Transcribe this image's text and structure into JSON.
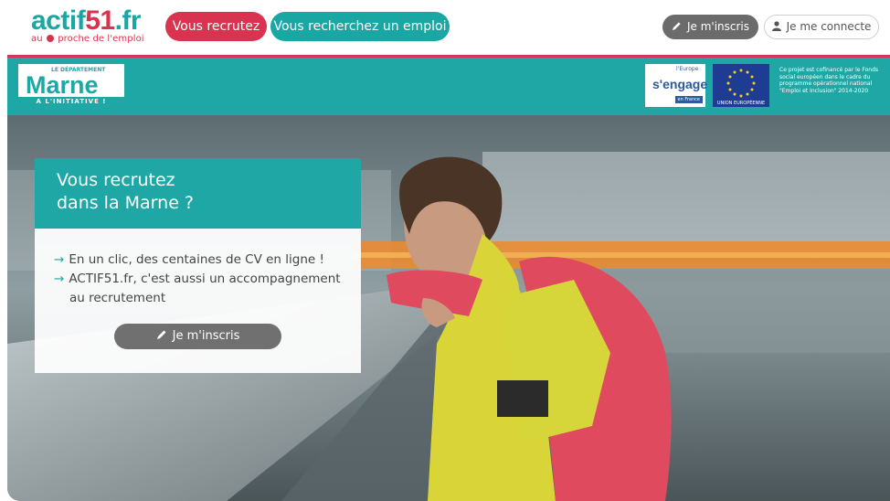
{
  "header": {
    "logo_main_a": "actif",
    "logo_main_b": "51",
    "logo_main_c": ".fr",
    "logo_sub_a": "au",
    "logo_sub_b": "proche de l'emploi",
    "nav": {
      "recruit_label": "Vous recrutez",
      "search_label": "Vous recherchez un emploi"
    },
    "signup_label": "Je m'inscris",
    "login_label": "Je me connecte"
  },
  "partner_band": {
    "marne_dept": "LE DÉPARTEMENT",
    "marne_name": "Marne",
    "marne_tagline": "A L'INITIATIVE !",
    "europe_small": "l'Europe",
    "europe_big": "s'engage",
    "europe_country": "en France",
    "eu_label": "UNION EUROPÉENNE",
    "eu_text": "Ce projet est cofinancé par le Fonds social européen dans le cadre du programme opérationnel national \"Emploi et Inclusion\" 2014-2020"
  },
  "hero": {
    "title_line1": "Vous recrutez",
    "title_line2": "dans la Marne ?",
    "bullet1": "En un clic, des centaines de CV en ligne !",
    "bullet2": "ACTIF51.fr, c'est aussi un accompagnement",
    "bullet2_cont": "au recrutement",
    "cta_label": "Je m'inscris"
  },
  "colors": {
    "teal": "#1ea7a4",
    "red": "#d9344f",
    "gray": "#6b6b6b"
  }
}
